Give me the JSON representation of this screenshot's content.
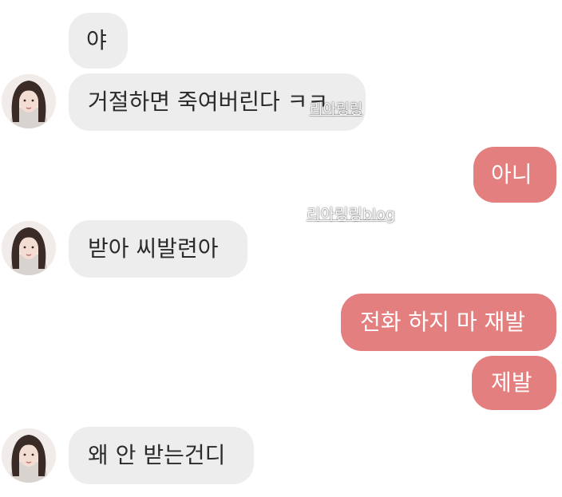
{
  "messages": [
    {
      "side": "in",
      "text": "야"
    },
    {
      "side": "in",
      "text": "거절하면 죽여버린다 ㅋㅋ"
    },
    {
      "side": "out",
      "text": "아니"
    },
    {
      "side": "in",
      "text": "받아 씨발련아"
    },
    {
      "side": "out",
      "text": "전화 하지 마 재발"
    },
    {
      "side": "out",
      "text": "제발"
    },
    {
      "side": "in",
      "text": "왜 안 받는건디"
    }
  ],
  "watermarks": [
    "리아링링",
    "리아링링blog"
  ],
  "colors": {
    "incoming_bubble": "#ededed",
    "outgoing_bubble": "#e47f7f",
    "incoming_text": "#2b2b2b",
    "outgoing_text": "#ffffff"
  },
  "avatar_icon": "profile-photo"
}
